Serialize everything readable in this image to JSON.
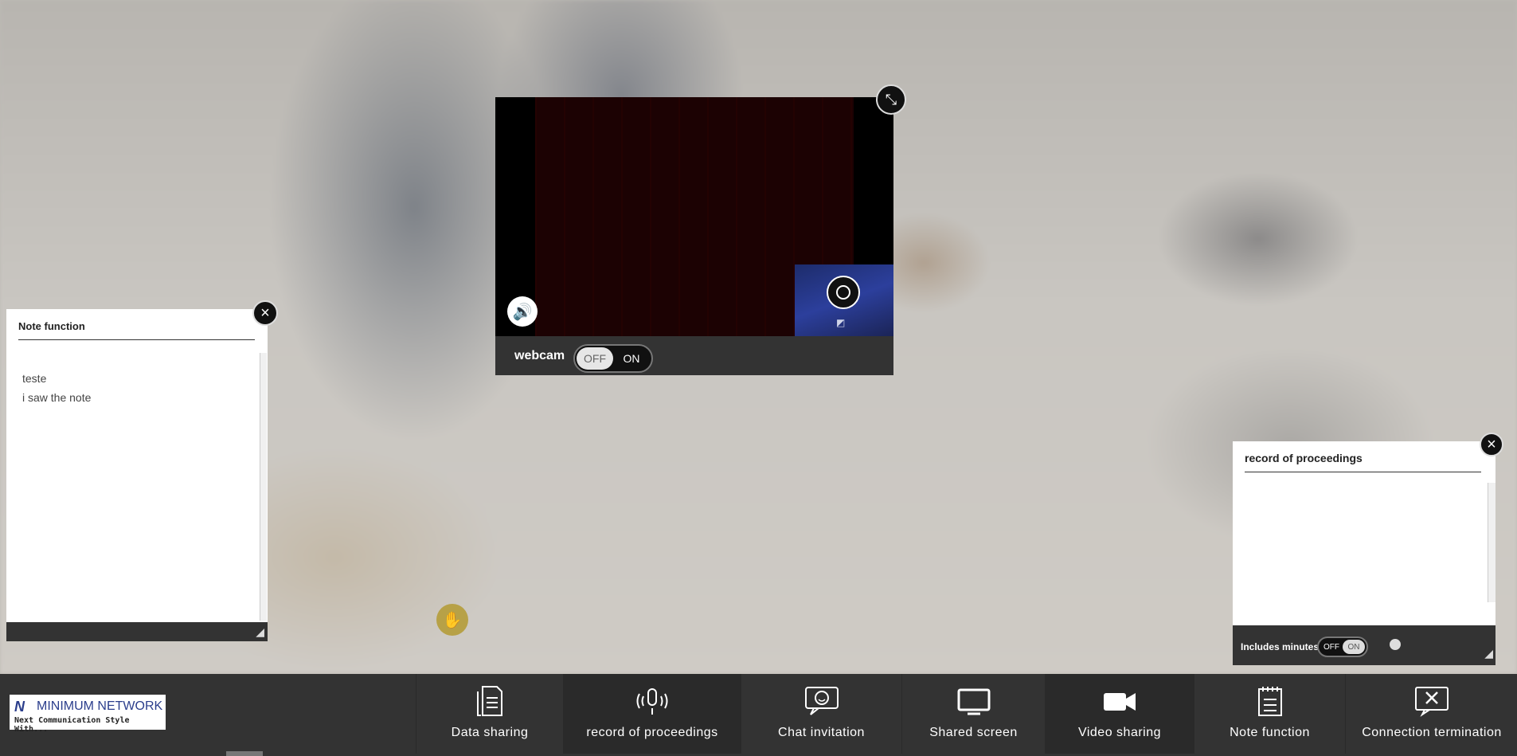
{
  "video": {
    "webcam_label": "webcam",
    "toggle_off": "OFF",
    "toggle_on": "ON"
  },
  "note_panel": {
    "title": "Note function",
    "content": "teste\ni saw the note"
  },
  "record_panel": {
    "title": "record of proceedings",
    "includes_minutes_label": "Includes minutes",
    "toggle_off": "OFF",
    "toggle_on": "ON"
  },
  "logo": {
    "name": "MINIMUM NETWORK",
    "tagline": "Next Communication Style With..."
  },
  "toolbar": {
    "items": [
      {
        "label": "Data sharing",
        "icon": "document-icon"
      },
      {
        "label": "record of proceedings",
        "icon": "microphone-icon"
      },
      {
        "label": "Chat invitation",
        "icon": "chat-icon"
      },
      {
        "label": "Shared screen",
        "icon": "monitor-icon"
      },
      {
        "label": "Video sharing",
        "icon": "video-camera-icon"
      },
      {
        "label": "Note function",
        "icon": "notepad-icon"
      },
      {
        "label": "Connection termination",
        "icon": "close-box-icon"
      }
    ]
  },
  "icons": {
    "speaker": "speaker-icon",
    "expand": "expand-icon",
    "close": "close-icon",
    "raise_hand": "hand-icon",
    "resize": "resize-icon"
  },
  "colors": {
    "panel_dark": "#333333",
    "toolbar_bg": "#333333",
    "hand_button": "#b7a147",
    "logo_blue": "#2b3e8c"
  }
}
